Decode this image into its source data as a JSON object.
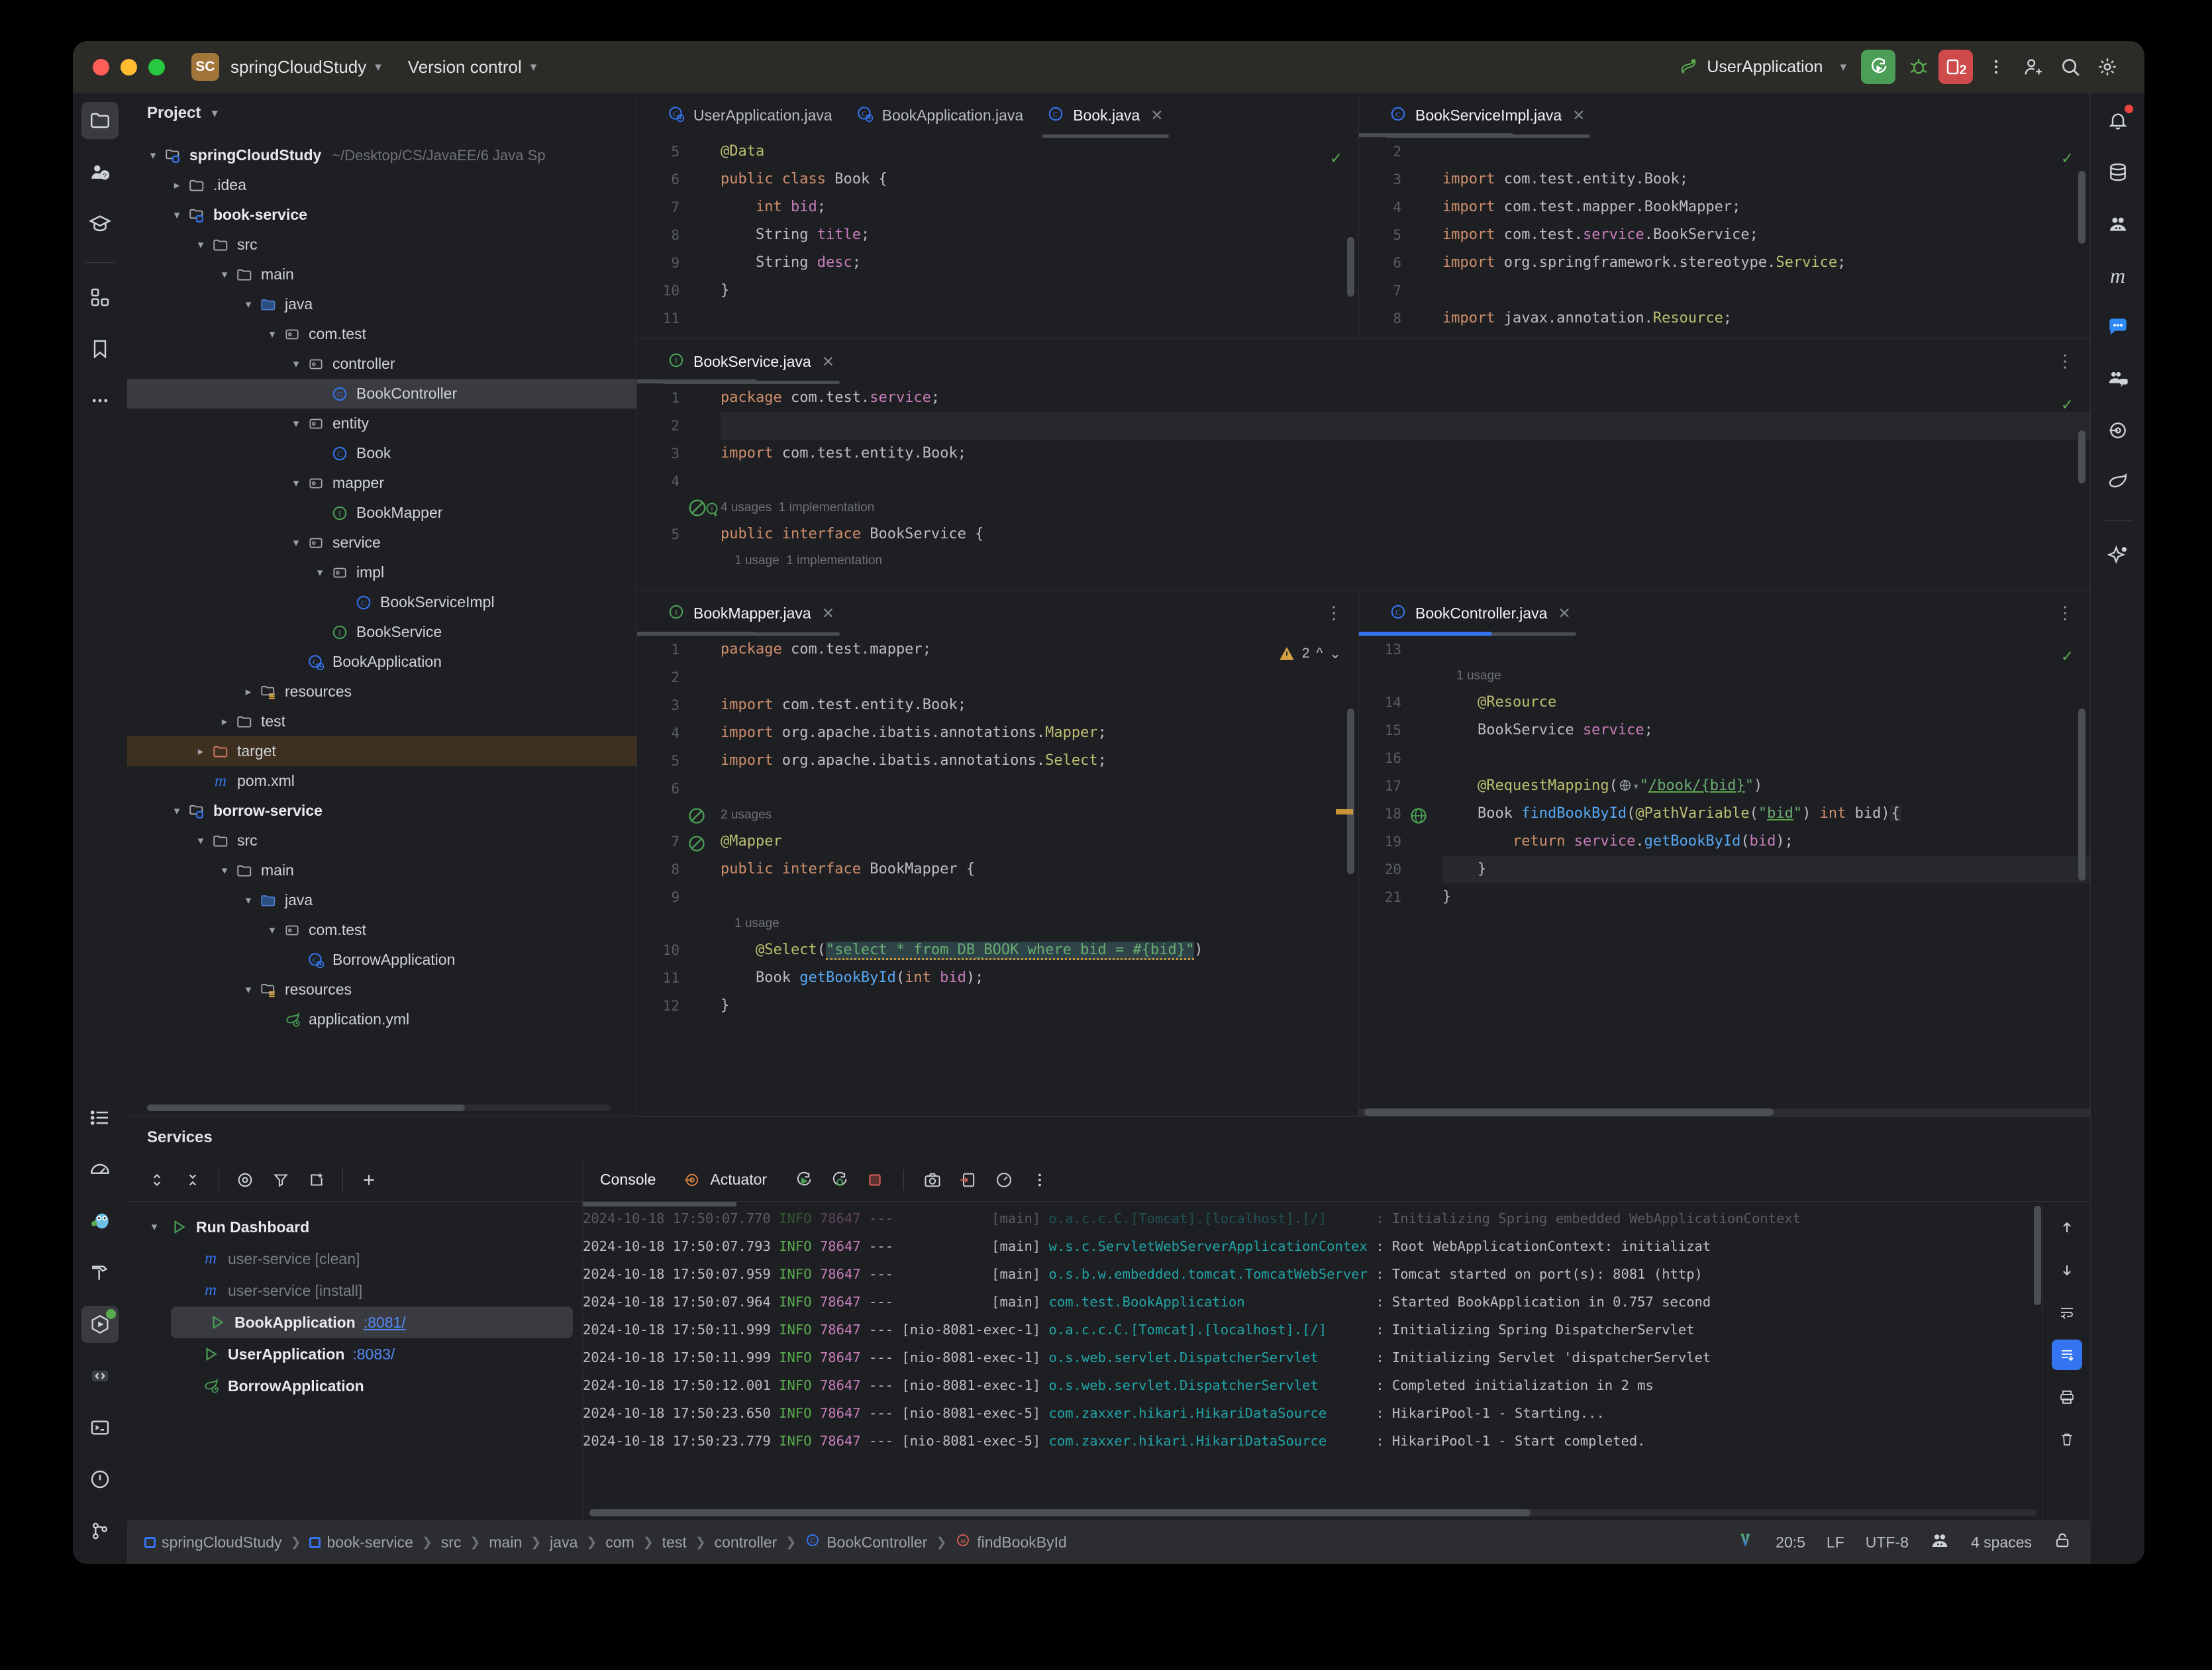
{
  "titlebar": {
    "project_badge": "SC",
    "project_name": "springCloudStudy",
    "vcs_label": "Version control",
    "run_config": "UserApplication",
    "notification_count": "2"
  },
  "left_rail": {
    "top": [
      "project-icon",
      "ai-assistant-icon",
      "learn-icon",
      "structure-icon",
      "bookmarks-icon",
      "more-icon"
    ],
    "bottom": [
      "todo-icon",
      "profiler-icon",
      "go-icon",
      "build-icon",
      "services-icon",
      "debug-icon",
      "terminal-icon",
      "problems-icon",
      "git-icon"
    ]
  },
  "right_rail": [
    "notifications-icon",
    "database-icon",
    "account-icon",
    "maven-icon",
    "chat-icon",
    "code-with-me-icon",
    "actuator-icon",
    "spring-icon",
    "ai-sparkle-icon"
  ],
  "project_panel": {
    "title": "Project",
    "tree": [
      {
        "depth": 0,
        "arrow": "down",
        "icon": "module-folder",
        "label": "springCloudStudy",
        "bold": true,
        "sub": "~/Desktop/CS/JavaEE/6 Java Sp"
      },
      {
        "depth": 1,
        "arrow": "right",
        "icon": "folder",
        "label": ".idea"
      },
      {
        "depth": 1,
        "arrow": "down",
        "icon": "module-folder",
        "label": "book-service",
        "bold": true
      },
      {
        "depth": 2,
        "arrow": "down",
        "icon": "folder",
        "label": "src"
      },
      {
        "depth": 3,
        "arrow": "down",
        "icon": "folder",
        "label": "main"
      },
      {
        "depth": 4,
        "arrow": "down",
        "icon": "source-folder",
        "label": "java"
      },
      {
        "depth": 5,
        "arrow": "down",
        "icon": "package",
        "label": "com.test"
      },
      {
        "depth": 6,
        "arrow": "down",
        "icon": "package",
        "label": "controller"
      },
      {
        "depth": 7,
        "arrow": "none",
        "icon": "class",
        "label": "BookController",
        "selected": true
      },
      {
        "depth": 6,
        "arrow": "down",
        "icon": "package",
        "label": "entity"
      },
      {
        "depth": 7,
        "arrow": "none",
        "icon": "class",
        "label": "Book"
      },
      {
        "depth": 6,
        "arrow": "down",
        "icon": "package",
        "label": "mapper"
      },
      {
        "depth": 7,
        "arrow": "none",
        "icon": "interface",
        "label": "BookMapper"
      },
      {
        "depth": 6,
        "arrow": "down",
        "icon": "package",
        "label": "service"
      },
      {
        "depth": 7,
        "arrow": "down",
        "icon": "package",
        "label": "impl"
      },
      {
        "depth": 8,
        "arrow": "none",
        "icon": "class",
        "label": "BookServiceImpl"
      },
      {
        "depth": 7,
        "arrow": "none",
        "icon": "interface",
        "label": "BookService"
      },
      {
        "depth": 6,
        "arrow": "none",
        "icon": "spring-class",
        "label": "BookApplication"
      },
      {
        "depth": 4,
        "arrow": "right",
        "icon": "resource-folder",
        "label": "resources"
      },
      {
        "depth": 3,
        "arrow": "right",
        "icon": "folder",
        "label": "test"
      },
      {
        "depth": 2,
        "arrow": "right",
        "icon": "target-folder",
        "label": "target",
        "highlight": true
      },
      {
        "depth": 2,
        "arrow": "none",
        "icon": "maven",
        "label": "pom.xml"
      },
      {
        "depth": 1,
        "arrow": "down",
        "icon": "module-folder",
        "label": "borrow-service",
        "bold": true
      },
      {
        "depth": 2,
        "arrow": "down",
        "icon": "folder",
        "label": "src"
      },
      {
        "depth": 3,
        "arrow": "down",
        "icon": "folder",
        "label": "main"
      },
      {
        "depth": 4,
        "arrow": "down",
        "icon": "source-folder",
        "label": "java"
      },
      {
        "depth": 5,
        "arrow": "down",
        "icon": "package",
        "label": "com.test"
      },
      {
        "depth": 6,
        "arrow": "none",
        "icon": "spring-class",
        "label": "BorrowApplication"
      },
      {
        "depth": 4,
        "arrow": "down",
        "icon": "resource-folder",
        "label": "resources"
      },
      {
        "depth": 5,
        "arrow": "none",
        "icon": "spring-yaml",
        "label": "application.yml"
      }
    ]
  },
  "editors": {
    "pane_book": {
      "tabs": [
        {
          "label": "UserApplication.java",
          "icon": "spring-class",
          "active": false,
          "closable": false
        },
        {
          "label": "BookApplication.java",
          "icon": "spring-class",
          "active": false,
          "closable": false
        },
        {
          "label": "Book.java",
          "icon": "class",
          "active": true,
          "closable": true
        }
      ],
      "lines": [
        {
          "no": "5",
          "code": "@Data",
          "kind": "ann"
        },
        {
          "no": "6",
          "code": "public class Book {"
        },
        {
          "no": "7",
          "code": "    int bid;"
        },
        {
          "no": "8",
          "code": "    String title;"
        },
        {
          "no": "9",
          "code": "    String desc;"
        },
        {
          "no": "10",
          "code": "}"
        },
        {
          "no": "11",
          "code": ""
        }
      ]
    },
    "pane_serviceimpl": {
      "tabs": [
        {
          "label": "BookServiceImpl.java",
          "icon": "class",
          "active": true,
          "closable": true
        }
      ],
      "lines": [
        {
          "no": "2",
          "code": ""
        },
        {
          "no": "3",
          "code": "import com.test.entity.Book;"
        },
        {
          "no": "4",
          "code": "import com.test.mapper.BookMapper;"
        },
        {
          "no": "5",
          "code": "import com.test.service.BookService;"
        },
        {
          "no": "6",
          "code": "import org.springframework.stereotype.Service;"
        },
        {
          "no": "7",
          "code": ""
        },
        {
          "no": "8",
          "code": "import javax.annotation.Resource;"
        }
      ]
    },
    "pane_service": {
      "tabs": [
        {
          "label": "BookService.java",
          "icon": "interface",
          "active": true,
          "closable": true
        }
      ],
      "lines": [
        {
          "no": "1",
          "code": "package com.test.service;"
        },
        {
          "no": "2",
          "code": "",
          "current": true
        },
        {
          "no": "3",
          "code": "import com.test.entity.Book;"
        },
        {
          "no": "4",
          "code": ""
        },
        {
          "no": "",
          "hint": "4 usages  1 implementation"
        },
        {
          "no": "5",
          "code": "public interface BookService {"
        },
        {
          "no": "",
          "hint": "    1 usage  1 implementation"
        }
      ]
    },
    "pane_mapper": {
      "tabs": [
        {
          "label": "BookMapper.java",
          "icon": "interface",
          "active": true,
          "closable": true
        }
      ],
      "warning_count": "2",
      "lines": [
        {
          "no": "1",
          "code": "package com.test.mapper;"
        },
        {
          "no": "2",
          "code": ""
        },
        {
          "no": "3",
          "code": "import com.test.entity.Book;"
        },
        {
          "no": "4",
          "code": "import org.apache.ibatis.annotations.Mapper;"
        },
        {
          "no": "5",
          "code": "import org.apache.ibatis.annotations.Select;"
        },
        {
          "no": "6",
          "code": ""
        },
        {
          "no": "",
          "hint": "2 usages"
        },
        {
          "no": "7",
          "code": "@Mapper"
        },
        {
          "no": "8",
          "code": "public interface BookMapper {"
        },
        {
          "no": "9",
          "code": ""
        },
        {
          "no": "",
          "hint": "    1 usage"
        },
        {
          "no": "10",
          "code": "    @Select(\"select * from DB_BOOK where bid = #{bid}\")"
        },
        {
          "no": "11",
          "code": "    Book getBookById(int bid);"
        },
        {
          "no": "12",
          "code": "}"
        }
      ]
    },
    "pane_controller": {
      "tabs": [
        {
          "label": "BookController.java",
          "icon": "class",
          "active": true,
          "closable": true
        }
      ],
      "lines": [
        {
          "no": "13",
          "code": ""
        },
        {
          "no": "",
          "hint": "    1 usage"
        },
        {
          "no": "14",
          "code": "    @Resource"
        },
        {
          "no": "15",
          "code": "    BookService service;"
        },
        {
          "no": "16",
          "code": ""
        },
        {
          "no": "17",
          "code": "    @RequestMapping(\"/book/{bid}\")"
        },
        {
          "no": "18",
          "code": "    Book findBookById(@PathVariable(\"bid\") int bid){"
        },
        {
          "no": "19",
          "code": "        return service.getBookById(bid);"
        },
        {
          "no": "20",
          "code": "    }",
          "current": true
        },
        {
          "no": "21",
          "code": "}"
        }
      ]
    }
  },
  "services": {
    "title": "Services",
    "toolbar_icons": [
      "expand-collapse-icon",
      "collapse-all-icon",
      "show-icon",
      "filter-icon",
      "new-tab-icon",
      "add-icon"
    ],
    "tree": [
      {
        "depth": 0,
        "arrow": "down",
        "icon": "run-icon",
        "label": "Run Dashboard"
      },
      {
        "depth": 1,
        "arrow": "none",
        "icon": "maven",
        "label": "user-service [clean]",
        "dim": true
      },
      {
        "depth": 1,
        "arrow": "none",
        "icon": "maven",
        "label": "user-service [install]",
        "dim": true
      },
      {
        "depth": 1,
        "arrow": "none",
        "icon": "run-icon",
        "label": "BookApplication",
        "port": ":8081/",
        "selected": true,
        "port_underline": true
      },
      {
        "depth": 1,
        "arrow": "none",
        "icon": "run-icon",
        "label": "UserApplication",
        "port": ":8083/"
      },
      {
        "depth": 1,
        "arrow": "none",
        "icon": "spring-leaf",
        "label": "BorrowApplication"
      }
    ],
    "console": {
      "tabs": [
        {
          "label": "Console",
          "active": true
        },
        {
          "label": "Actuator",
          "icon": "actuator-icon",
          "active": false
        }
      ],
      "toolbar_icons": [
        "rerun-icon",
        "rerun-debug-icon",
        "stop-icon",
        "screenshot-icon",
        "export-icon",
        "profile-icon",
        "kebab-icon"
      ],
      "side_icons": [
        "scroll-up-icon",
        "scroll-down-icon",
        "soft-wrap-icon",
        "scroll-to-end-icon",
        "print-icon",
        "clear-all-icon"
      ],
      "log": [
        {
          "ts": "2024-10-18 17:50:07.770",
          "lvl": "INFO",
          "pid": "78647",
          "thread": "main",
          "cls": "o.a.c.c.C.[Tomcat].[localhost].[/]",
          "msg": "Initializing Spring embedded WebApplicationContext",
          "faded": true
        },
        {
          "ts": "2024-10-18 17:50:07.793",
          "lvl": "INFO",
          "pid": "78647",
          "thread": "main",
          "cls": "w.s.c.ServletWebServerApplicationContext",
          "msg": "Root WebApplicationContext: initializat"
        },
        {
          "ts": "2024-10-18 17:50:07.959",
          "lvl": "INFO",
          "pid": "78647",
          "thread": "main",
          "cls": "o.s.b.w.embedded.tomcat.TomcatWebServer",
          "msg": "Tomcat started on port(s): 8081 (http)"
        },
        {
          "ts": "2024-10-18 17:50:07.964",
          "lvl": "INFO",
          "pid": "78647",
          "thread": "main",
          "cls": "com.test.BookApplication",
          "msg": "Started BookApplication in 0.757 second"
        },
        {
          "ts": "2024-10-18 17:50:11.999",
          "lvl": "INFO",
          "pid": "78647",
          "thread": "nio-8081-exec-1",
          "cls": "o.a.c.c.C.[Tomcat].[localhost].[/]",
          "msg": "Initializing Spring DispatcherServlet"
        },
        {
          "ts": "2024-10-18 17:50:11.999",
          "lvl": "INFO",
          "pid": "78647",
          "thread": "nio-8081-exec-1",
          "cls": "o.s.web.servlet.DispatcherServlet",
          "msg": "Initializing Servlet 'dispatcherServlet"
        },
        {
          "ts": "2024-10-18 17:50:12.001",
          "lvl": "INFO",
          "pid": "78647",
          "thread": "nio-8081-exec-1",
          "cls": "o.s.web.servlet.DispatcherServlet",
          "msg": "Completed initialization in 2 ms"
        },
        {
          "ts": "2024-10-18 17:50:23.650",
          "lvl": "INFO",
          "pid": "78647",
          "thread": "nio-8081-exec-5",
          "cls": "com.zaxxer.hikari.HikariDataSource",
          "msg": "HikariPool-1 - Starting..."
        },
        {
          "ts": "2024-10-18 17:50:23.779",
          "lvl": "INFO",
          "pid": "78647",
          "thread": "nio-8081-exec-5",
          "cls": "com.zaxxer.hikari.HikariDataSource",
          "msg": "HikariPool-1 - Start completed."
        }
      ]
    }
  },
  "status_bar": {
    "breadcrumb": [
      "springCloudStudy",
      "book-service",
      "src",
      "main",
      "java",
      "com",
      "test",
      "controller",
      "BookController",
      "findBookById"
    ],
    "caret": "20:5",
    "line_sep": "LF",
    "encoding": "UTF-8",
    "indent": "4 spaces"
  }
}
